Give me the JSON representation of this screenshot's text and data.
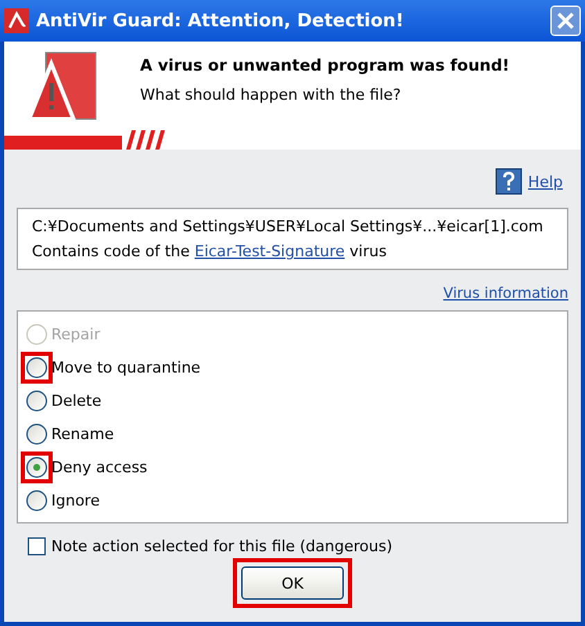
{
  "window": {
    "title": "AntiVir Guard: Attention, Detection!"
  },
  "header": {
    "heading": "A virus or unwanted program was found!",
    "question": "What should happen with the file?"
  },
  "help": {
    "label": "Help"
  },
  "detection": {
    "path": "C:¥Documents and Settings¥USER¥Local Settings¥...¥eicar[1].com",
    "prefix": "Contains code of the",
    "signature": "Eicar-Test-Signature",
    "suffix": "virus"
  },
  "virus_info_link": "Virus information",
  "actions": [
    {
      "label": "Repair",
      "selected": false,
      "disabled": true,
      "highlighted": false
    },
    {
      "label": "Move to quarantine",
      "selected": false,
      "disabled": false,
      "highlighted": true
    },
    {
      "label": "Delete",
      "selected": false,
      "disabled": false,
      "highlighted": false
    },
    {
      "label": "Rename",
      "selected": false,
      "disabled": false,
      "highlighted": false
    },
    {
      "label": "Deny access",
      "selected": true,
      "disabled": false,
      "highlighted": true
    },
    {
      "label": "Ignore",
      "selected": false,
      "disabled": false,
      "highlighted": false
    }
  ],
  "note_checkbox": {
    "label": "Note action selected for this file (dangerous)",
    "checked": false
  },
  "ok_button": {
    "label": "OK",
    "highlighted": true
  }
}
